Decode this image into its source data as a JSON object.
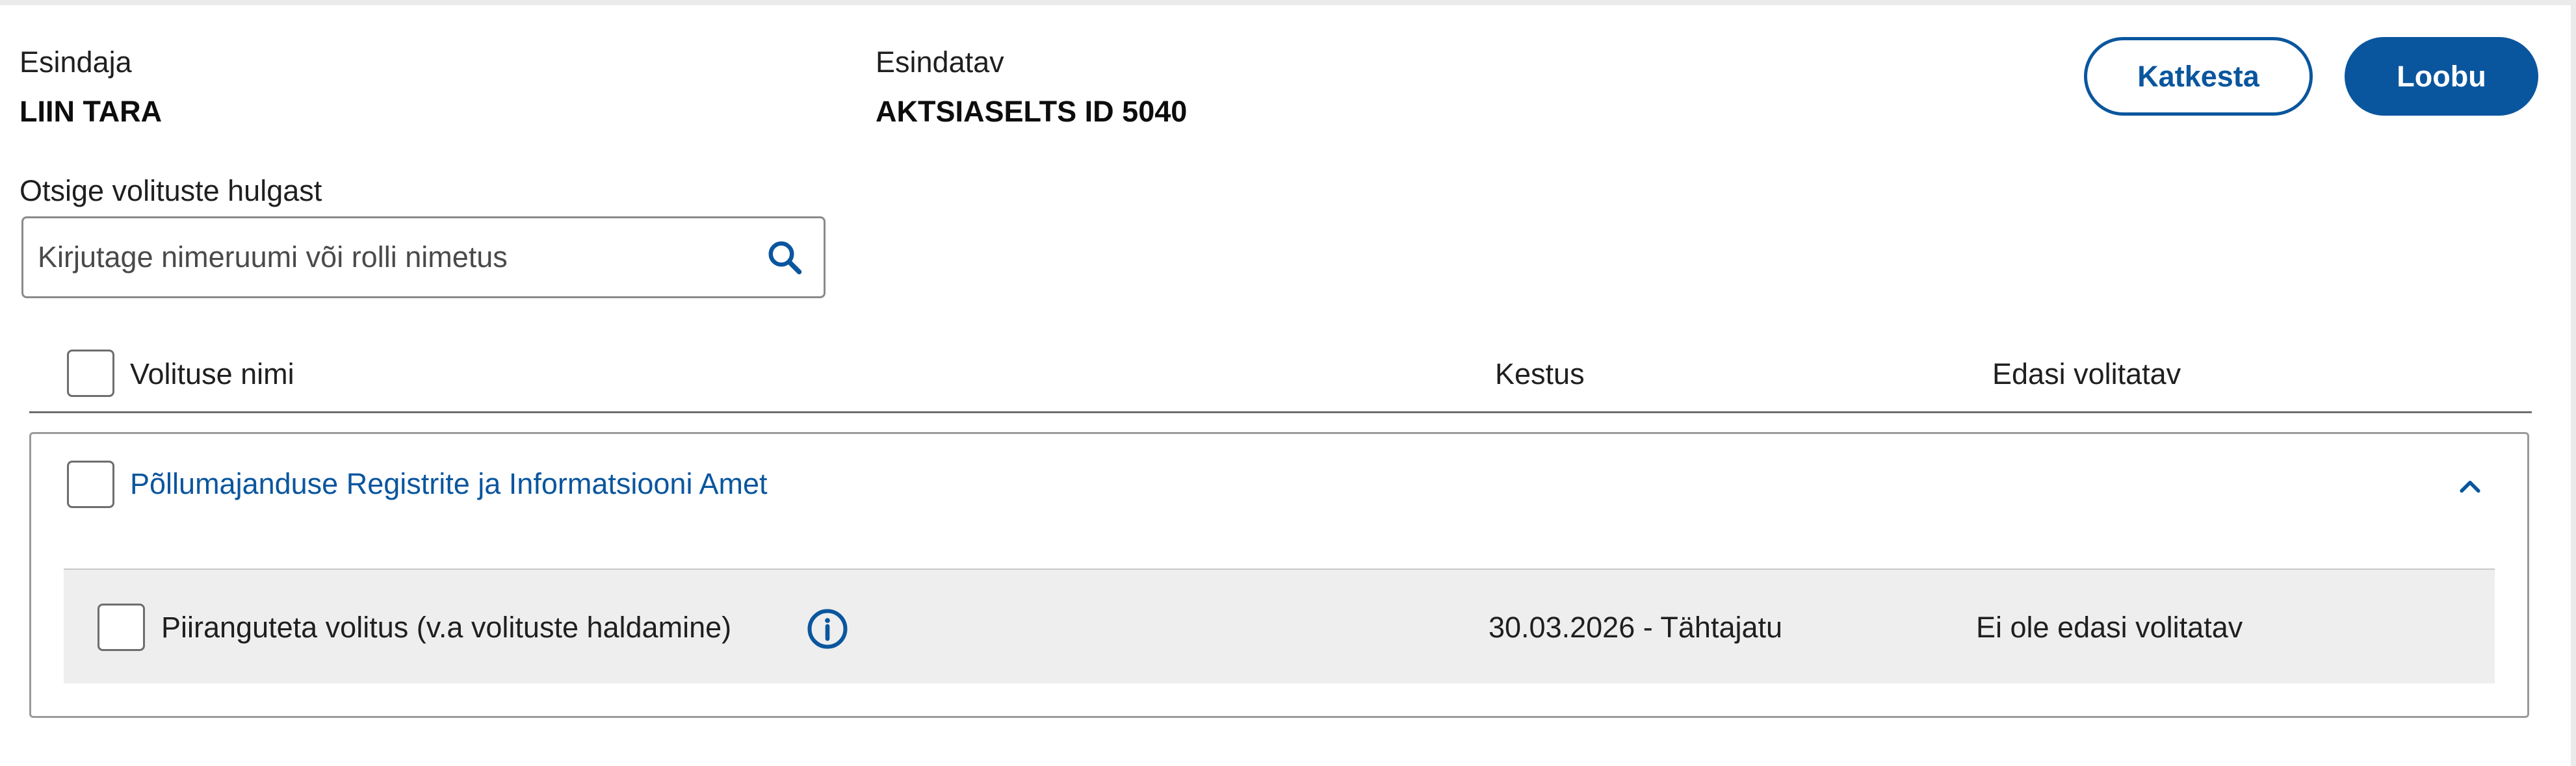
{
  "header": {
    "esindaja_label": "Esindaja",
    "esindaja_value": "LIIN TARA",
    "esindatav_label": "Esindatav",
    "esindatav_value": "AKTSIASELTS ID 5040",
    "cancel_label": "Katkesta",
    "abandon_label": "Loobu"
  },
  "search": {
    "label": "Otsige volituste hulgast",
    "placeholder": "Kirjutage nimeruumi või rolli nimetus",
    "icon": "search-icon"
  },
  "table": {
    "columns": [
      "Volituse nimi",
      "Kestus",
      "Edasi volitatav"
    ],
    "groups": [
      {
        "title": "Põllumajanduse Registrite ja Informatsiooni Amet",
        "expanded": true,
        "rows": [
          {
            "name": "Piiranguteta volitus (v.a volituste haldamine)",
            "duration": "30.03.2026 - Tähtajatu",
            "delegable": "Ei ole edasi volitatav",
            "info_icon": "info-icon"
          }
        ]
      }
    ]
  },
  "colors": {
    "primary": "#0a569e",
    "row_bg": "#eeeeef",
    "border": "#9a9a9a"
  }
}
